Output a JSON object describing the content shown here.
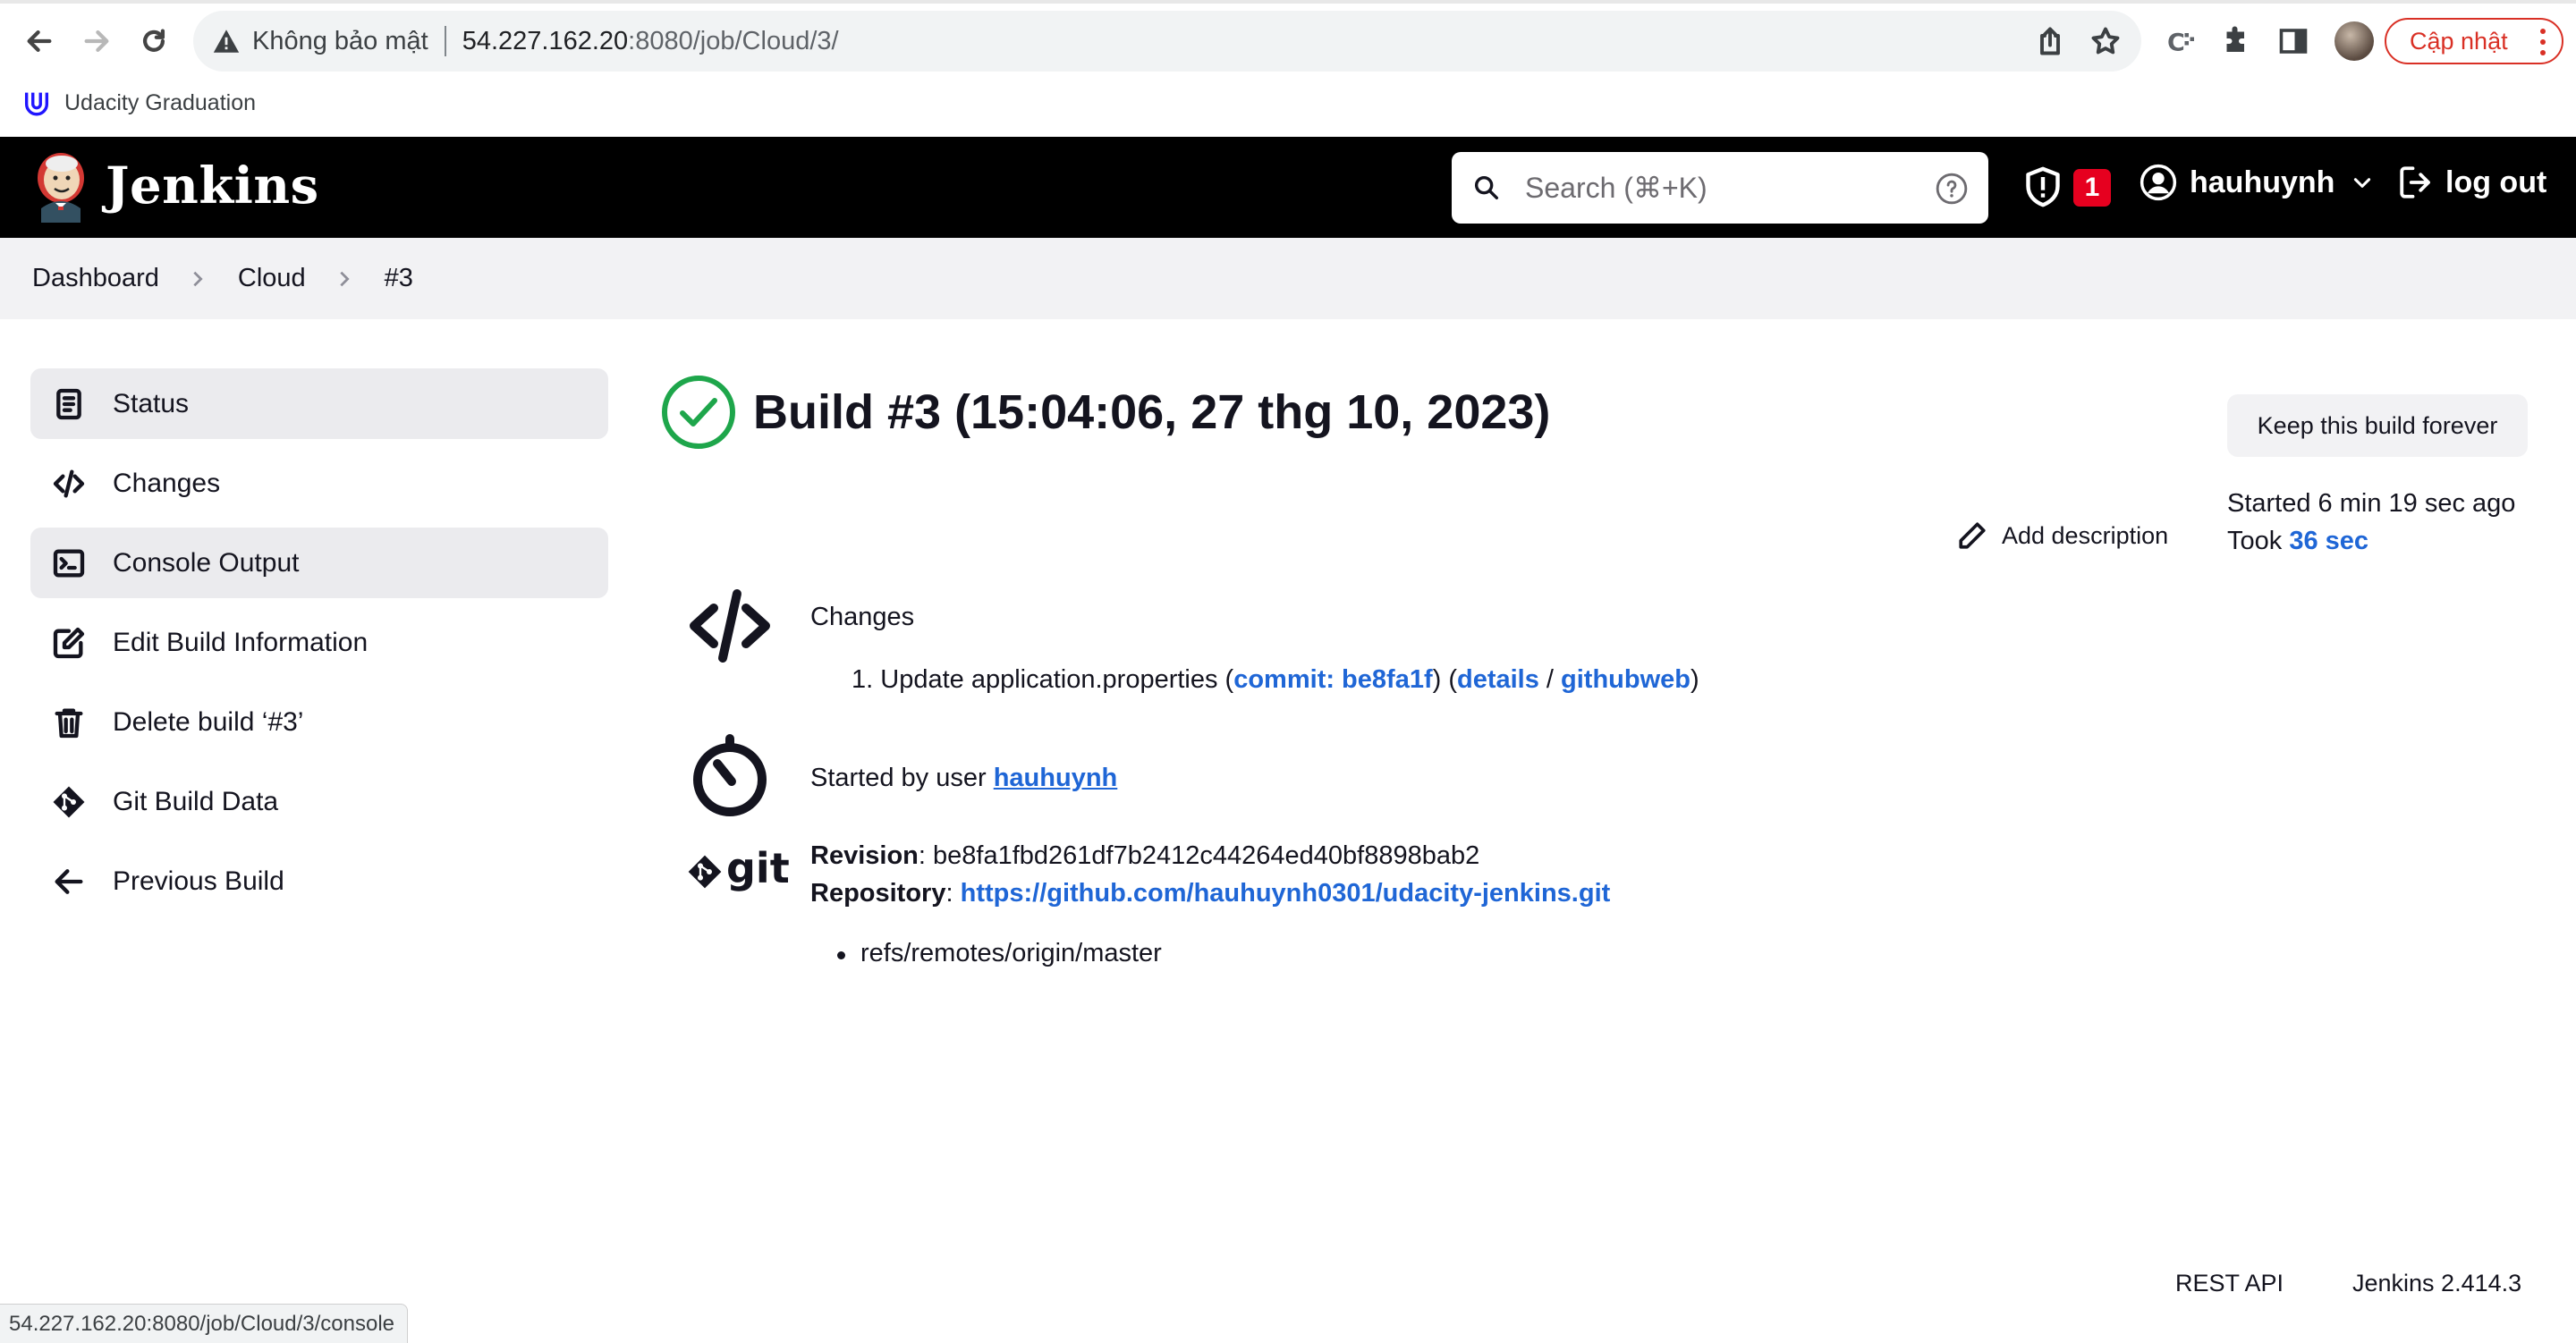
{
  "browser": {
    "security_label": "Không bảo mật",
    "url_host": "54.227.162.20",
    "url_rest": ":8080/job/Cloud/3/",
    "update_label": "Cập nhật",
    "bookmark_label": "Udacity Graduation",
    "status_url": "54.227.162.20:8080/job/Cloud/3/console"
  },
  "header": {
    "title": "Jenkins",
    "search_placeholder": "Search (⌘+K)",
    "security_badge": "1",
    "user": "hauhuynh",
    "logout": "log out"
  },
  "breadcrumb": [
    "Dashboard",
    "Cloud",
    "#3"
  ],
  "sidebar": {
    "items": [
      {
        "label": "Status",
        "icon": "status-icon"
      },
      {
        "label": "Changes",
        "icon": "code-icon"
      },
      {
        "label": "Console Output",
        "icon": "terminal-icon"
      },
      {
        "label": "Edit Build Information",
        "icon": "edit-icon"
      },
      {
        "label": "Delete build ‘#3’",
        "icon": "trash-icon"
      },
      {
        "label": "Git Build Data",
        "icon": "git-icon"
      },
      {
        "label": "Previous Build",
        "icon": "arrow-left-icon"
      }
    ]
  },
  "build": {
    "title": "Build #3 (15:04:06, 27 thg 10, 2023)",
    "keep_forever": "Keep this build forever",
    "started_ago": "Started 6 min 19 sec ago",
    "took_prefix": "Took ",
    "took_value": "36 sec",
    "add_description": "Add description",
    "changes_heading": "Changes",
    "change": {
      "index": "1.",
      "message": "Update application.properties",
      "commit_link": "commit: be8fa1f",
      "details_link": "details",
      "githubweb_link": "githubweb"
    },
    "started_by_prefix": "Started by user ",
    "started_by_user": "hauhuynh",
    "git_word": "git",
    "revision_label": "Revision",
    "revision_value": "be8fa1fbd261df7b2412c44264ed40bf8898bab2",
    "repository_label": "Repository",
    "repository_url": "https://github.com/hauhuynh0301/udacity-jenkins.git",
    "branch": "refs/remotes/origin/master"
  },
  "footer": {
    "rest_api": "REST API",
    "version": "Jenkins 2.414.3"
  },
  "colors": {
    "success": "#1ea64b",
    "link": "#1f66d6",
    "badge": "#e6001f"
  }
}
